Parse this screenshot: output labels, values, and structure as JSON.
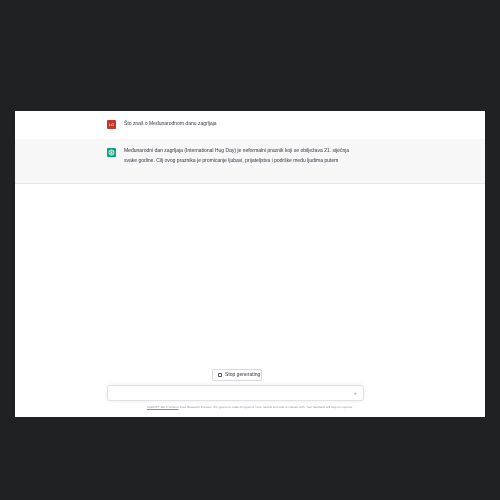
{
  "conversation": {
    "user_message": {
      "avatar_text": "LG",
      "text": "Što znaš o Međunarodnom danu zagrljaja"
    },
    "assistant_message": {
      "text": "Međunarodni dan zagrljaja (International Hug Day) je neformalni praznik koji se obilježava 21. siječnja svake godine. Cilj ovog praznika je promicanje ljubavi, prijateljstva i podrške među ljudima putem"
    }
  },
  "controls": {
    "stop_label": "Stop generating",
    "input_placeholder": "",
    "send_icon": "paper-plane-icon"
  },
  "footer": {
    "link_text": "ChatGPT Jan 9 Version",
    "text": ". Free Research Preview. Our goal is to make AI systems more natural and safe to interact with. Your feedback will help us improve."
  },
  "colors": {
    "background": "#202123",
    "assistant_bg": "#f7f7f8",
    "user_avatar": "#c0392b",
    "assistant_avatar": "#10a37f"
  }
}
